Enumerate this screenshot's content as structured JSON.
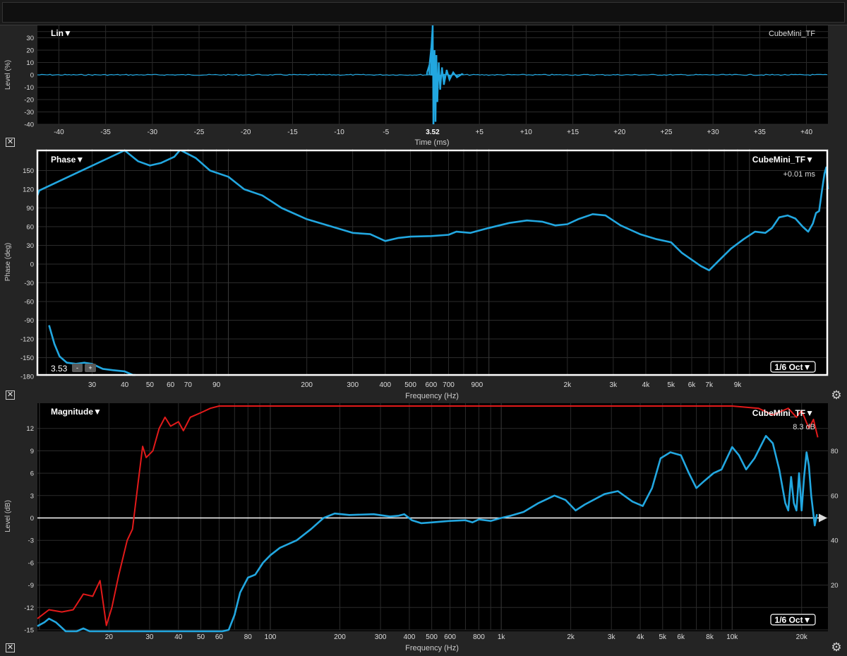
{
  "colors": {
    "trace_blue": "#22a7e0",
    "trace_red": "#e21a1a",
    "zero_line": "#ffffff",
    "grid": "#2b2b2b",
    "plot_bg": "#000000"
  },
  "icons": {
    "close": "close-icon",
    "settings": "gear-icon",
    "marker": "arrow-marker-icon"
  },
  "chart_data": [
    {
      "type": "line",
      "panel": "impulse",
      "mode_label": "Lin▼",
      "trace_label": "CubeMini_TF",
      "ylabel": "Level (%)",
      "xlabel": "Time (ms)",
      "ylim": [
        -40,
        40
      ],
      "y_ticks": [
        -40,
        -30,
        -20,
        -10,
        0,
        10,
        20,
        30
      ],
      "x_ticks": [
        {
          "v": -40,
          "label": "-40"
        },
        {
          "v": -35,
          "label": "-35"
        },
        {
          "v": -30,
          "label": "-30"
        },
        {
          "v": -25,
          "label": "-25"
        },
        {
          "v": -20,
          "label": "-20"
        },
        {
          "v": -15,
          "label": "-15"
        },
        {
          "v": -10,
          "label": "-10"
        },
        {
          "v": -5,
          "label": "-5"
        },
        {
          "v": 0,
          "label": "3.52",
          "bold": true
        },
        {
          "v": 5,
          "label": "+5"
        },
        {
          "v": 10,
          "label": "+10"
        },
        {
          "v": 15,
          "label": "+15"
        },
        {
          "v": 20,
          "label": "+20"
        },
        {
          "v": 25,
          "label": "+25"
        },
        {
          "v": 30,
          "label": "+30"
        },
        {
          "v": 35,
          "label": "+35"
        },
        {
          "v": 40,
          "label": "+40"
        }
      ],
      "xlim": [
        -42.3,
        42.3
      ],
      "impulse": [
        {
          "t": -0.6,
          "v": 2
        },
        {
          "t": -0.35,
          "v": 8
        },
        {
          "t": -0.15,
          "v": 22
        },
        {
          "t": 0,
          "v": 40
        },
        {
          "t": 0.08,
          "v": -40
        },
        {
          "t": 0.2,
          "v": 20
        },
        {
          "t": 0.3,
          "v": -38
        },
        {
          "t": 0.4,
          "v": 16
        },
        {
          "t": 0.5,
          "v": -22
        },
        {
          "t": 0.65,
          "v": 10
        },
        {
          "t": 0.8,
          "v": -12
        },
        {
          "t": 1.0,
          "v": 6
        },
        {
          "t": 1.2,
          "v": -8
        },
        {
          "t": 1.5,
          "v": 4
        },
        {
          "t": 1.8,
          "v": -4
        },
        {
          "t": 2.2,
          "v": 2
        },
        {
          "t": 2.6,
          "v": -2
        },
        {
          "t": 3.2,
          "v": 1
        }
      ]
    },
    {
      "type": "line",
      "panel": "phase",
      "mode_label": "Phase▼",
      "trace_label": "CubeMini_TF▼",
      "delay_label": "+0.01 ms",
      "smoothing_label": "1/6 Oct▼",
      "cursor_value": "3.53",
      "cursor_minus": "-",
      "cursor_plus": "+",
      "ylabel": "Phase (deg)",
      "xlabel": "Frequency (Hz)",
      "ylim": [
        -180,
        180
      ],
      "y_ticks": [
        -180,
        -150,
        -120,
        -90,
        -60,
        -30,
        0,
        30,
        60,
        90,
        120,
        150
      ],
      "xlim": [
        18.5,
        20000
      ],
      "x_ticks": [
        {
          "v": 30,
          "label": "30"
        },
        {
          "v": 40,
          "label": "40"
        },
        {
          "v": 50,
          "label": "50"
        },
        {
          "v": 60,
          "label": "60"
        },
        {
          "v": 70,
          "label": "70"
        },
        {
          "v": 90,
          "label": "90"
        },
        {
          "v": 200,
          "label": "200"
        },
        {
          "v": 300,
          "label": "300"
        },
        {
          "v": 400,
          "label": "400"
        },
        {
          "v": 500,
          "label": "500"
        },
        {
          "v": 600,
          "label": "600"
        },
        {
          "v": 700,
          "label": "700"
        },
        {
          "v": 900,
          "label": "900"
        },
        {
          "v": 2000,
          "label": "2k"
        },
        {
          "v": 3000,
          "label": "3k"
        },
        {
          "v": 4000,
          "label": "4k"
        },
        {
          "v": 5000,
          "label": "5k"
        },
        {
          "v": 6000,
          "label": "6k"
        },
        {
          "v": 7000,
          "label": "7k"
        },
        {
          "v": 9000,
          "label": "9k"
        }
      ],
      "series": [
        {
          "values": [
            [
              18.5,
              110
            ],
            [
              18.8,
              118
            ],
            [
              40,
              185
            ],
            [
              45,
              165
            ],
            [
              50,
              158
            ],
            [
              55,
              162
            ],
            [
              62,
              172
            ],
            [
              65,
              182
            ]
          ]
        },
        {
          "values": [
            [
              66,
              182
            ],
            [
              75,
              170
            ],
            [
              85,
              150
            ],
            [
              100,
              140
            ],
            [
              115,
              120
            ],
            [
              135,
              110
            ],
            [
              160,
              90
            ],
            [
              200,
              72
            ],
            [
              250,
              60
            ],
            [
              300,
              50
            ],
            [
              350,
              48
            ],
            [
              400,
              37
            ],
            [
              450,
              42
            ],
            [
              500,
              44
            ],
            [
              600,
              45
            ],
            [
              700,
              47
            ],
            [
              750,
              52
            ],
            [
              850,
              50
            ],
            [
              1000,
              58
            ],
            [
              1200,
              66
            ],
            [
              1400,
              70
            ],
            [
              1600,
              68
            ],
            [
              1800,
              62
            ],
            [
              2000,
              64
            ],
            [
              2200,
              72
            ],
            [
              2500,
              80
            ],
            [
              2800,
              78
            ],
            [
              3200,
              62
            ],
            [
              3800,
              48
            ],
            [
              4400,
              40
            ],
            [
              5000,
              35
            ],
            [
              5500,
              18
            ],
            [
              6500,
              -3
            ],
            [
              7000,
              -10
            ],
            [
              7600,
              5
            ],
            [
              8500,
              25
            ],
            [
              9500,
              40
            ],
            [
              10500,
              52
            ],
            [
              11500,
              50
            ],
            [
              12200,
              58
            ],
            [
              13000,
              75
            ],
            [
              14000,
              78
            ],
            [
              15000,
              73
            ],
            [
              16000,
              60
            ],
            [
              16800,
              52
            ],
            [
              17500,
              65
            ],
            [
              18000,
              82
            ],
            [
              18500,
              85
            ],
            [
              19000,
              120
            ],
            [
              19400,
              145
            ],
            [
              19700,
              155
            ],
            [
              20000,
              120
            ]
          ]
        },
        {
          "values": [
            [
              20.5,
              -98
            ],
            [
              21.5,
              -128
            ],
            [
              22.5,
              -148
            ],
            [
              24,
              -158
            ],
            [
              26,
              -160
            ],
            [
              28,
              -158
            ],
            [
              30,
              -160
            ],
            [
              33,
              -168
            ],
            [
              36,
              -170
            ],
            [
              40,
              -172
            ],
            [
              43,
              -178
            ],
            [
              44,
              -182
            ]
          ]
        }
      ]
    },
    {
      "type": "line",
      "panel": "magnitude",
      "mode_label": "Magnitude▼",
      "trace_label": "CubeMini_TF▼",
      "value_label": "8.3 dB",
      "smoothing_label": "1/6 Oct▼",
      "ylabel": "Level (dB)",
      "xlabel": "Frequency (Hz)",
      "ylim": [
        -15,
        15
      ],
      "y_ticks": [
        -15,
        -12,
        -9,
        -6,
        -3,
        0,
        3,
        6,
        9,
        12
      ],
      "right_ylim": [
        0,
        100
      ],
      "right_y_ticks": [
        20,
        40,
        60,
        80
      ],
      "xlim": [
        9.8,
        26000
      ],
      "x_ticks": [
        {
          "v": 20,
          "label": "20"
        },
        {
          "v": 30,
          "label": "30"
        },
        {
          "v": 40,
          "label": "40"
        },
        {
          "v": 50,
          "label": "50"
        },
        {
          "v": 60,
          "label": "60"
        },
        {
          "v": 80,
          "label": "80"
        },
        {
          "v": 100,
          "label": "100"
        },
        {
          "v": 200,
          "label": "200"
        },
        {
          "v": 300,
          "label": "300"
        },
        {
          "v": 400,
          "label": "400"
        },
        {
          "v": 500,
          "label": "500"
        },
        {
          "v": 600,
          "label": "600"
        },
        {
          "v": 800,
          "label": "800"
        },
        {
          "v": 1000,
          "label": "1k"
        },
        {
          "v": 2000,
          "label": "2k"
        },
        {
          "v": 3000,
          "label": "3k"
        },
        {
          "v": 4000,
          "label": "4k"
        },
        {
          "v": 5000,
          "label": "5k"
        },
        {
          "v": 6000,
          "label": "6k"
        },
        {
          "v": 8000,
          "label": "8k"
        },
        {
          "v": 10000,
          "label": "10k"
        },
        {
          "v": 20000,
          "label": "20k"
        }
      ],
      "series": [
        {
          "axis": "right",
          "color": "#e21a1a",
          "values": [
            [
              9.8,
              5
            ],
            [
              11,
              9
            ],
            [
              12.5,
              8
            ],
            [
              14,
              9
            ],
            [
              15.5,
              16
            ],
            [
              17,
              15
            ],
            [
              18.3,
              22
            ],
            [
              19.5,
              2
            ],
            [
              20.6,
              10
            ],
            [
              22,
              24
            ],
            [
              24,
              40
            ],
            [
              25.3,
              45
            ],
            [
              26.7,
              65
            ],
            [
              28,
              82
            ],
            [
              29,
              77
            ],
            [
              31,
              80
            ],
            [
              33,
              90
            ],
            [
              35,
              95
            ],
            [
              37,
              91
            ],
            [
              40,
              93
            ],
            [
              42,
              89
            ],
            [
              45,
              95
            ],
            [
              50,
              97
            ],
            [
              55,
              99
            ],
            [
              60,
              100
            ],
            [
              70,
              100
            ],
            [
              100,
              100
            ],
            [
              1000,
              100
            ],
            [
              5000,
              100
            ],
            [
              10000,
              100
            ],
            [
              13000,
              99
            ],
            [
              15000,
              96
            ],
            [
              17500,
              99
            ],
            [
              19000,
              95
            ],
            [
              20000,
              98
            ],
            [
              21500,
              90
            ],
            [
              22500,
              94
            ],
            [
              23500,
              86
            ]
          ]
        },
        {
          "axis": "left",
          "color": "#22a7e0",
          "values": [
            [
              9.8,
              -14.5
            ],
            [
              10.5,
              -14
            ],
            [
              11,
              -13.5
            ],
            [
              11.8,
              -14
            ],
            [
              13,
              -15.3
            ],
            [
              14.5,
              -15.6
            ],
            [
              15.5,
              -14.8
            ],
            [
              16.5,
              -15.5
            ],
            [
              18,
              -16
            ],
            [
              62,
              -16
            ],
            [
              66,
              -15
            ],
            [
              70,
              -13
            ],
            [
              74,
              -10
            ],
            [
              80,
              -8
            ],
            [
              86,
              -7.6
            ],
            [
              93,
              -6
            ],
            [
              100,
              -5
            ],
            [
              110,
              -4
            ],
            [
              130,
              -3
            ],
            [
              150,
              -1.5
            ],
            [
              170,
              0
            ],
            [
              190,
              0.6
            ],
            [
              220,
              0.4
            ],
            [
              280,
              0.5
            ],
            [
              330,
              0.2
            ],
            [
              360,
              0.3
            ],
            [
              380,
              0.5
            ],
            [
              410,
              -0.3
            ],
            [
              450,
              -0.7
            ],
            [
              500,
              -0.6
            ],
            [
              600,
              -0.4
            ],
            [
              700,
              -0.3
            ],
            [
              750,
              -0.6
            ],
            [
              800,
              -0.2
            ],
            [
              900,
              -0.4
            ],
            [
              1000,
              0
            ],
            [
              1100,
              0.3
            ],
            [
              1250,
              0.8
            ],
            [
              1450,
              2.0
            ],
            [
              1700,
              3.0
            ],
            [
              1900,
              2.4
            ],
            [
              2100,
              1.0
            ],
            [
              2300,
              1.8
            ],
            [
              2800,
              3.2
            ],
            [
              3200,
              3.6
            ],
            [
              3700,
              2.2
            ],
            [
              4100,
              1.6
            ],
            [
              4500,
              4.0
            ],
            [
              4900,
              8.0
            ],
            [
              5400,
              8.8
            ],
            [
              6000,
              8.4
            ],
            [
              6500,
              6.0
            ],
            [
              7000,
              4.0
            ],
            [
              7600,
              5.0
            ],
            [
              8300,
              6.0
            ],
            [
              9000,
              6.5
            ],
            [
              10000,
              9.5
            ],
            [
              10700,
              8.4
            ],
            [
              11500,
              6.5
            ],
            [
              12500,
              8.0
            ],
            [
              14000,
              11.0
            ],
            [
              15000,
              10.0
            ],
            [
              16000,
              6.5
            ],
            [
              17000,
              2.0
            ],
            [
              17500,
              1.0
            ],
            [
              18000,
              5.5
            ],
            [
              18500,
              2.0
            ],
            [
              19000,
              1.0
            ],
            [
              19500,
              6.0
            ],
            [
              20000,
              1.0
            ],
            [
              20500,
              5.5
            ],
            [
              21000,
              8.8
            ],
            [
              21500,
              7.0
            ],
            [
              22000,
              3.0
            ],
            [
              22800,
              -1.0
            ],
            [
              23300,
              0.5
            ]
          ]
        }
      ]
    }
  ]
}
